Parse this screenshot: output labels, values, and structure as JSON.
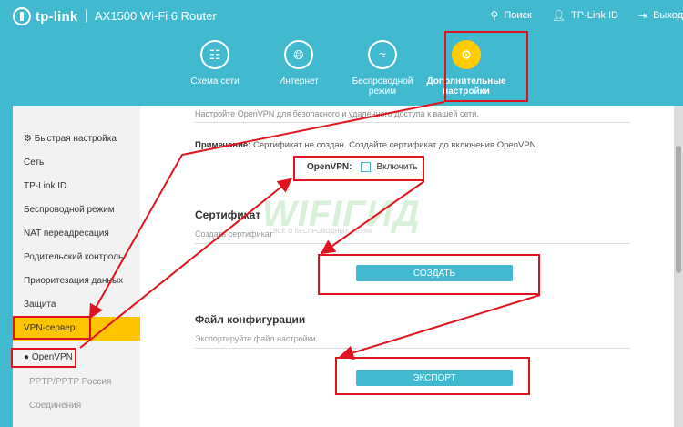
{
  "header": {
    "logo_text": "tp-link",
    "model": "AX1500 Wi-Fi 6 Router",
    "actions": [
      {
        "label": "Поиск",
        "icon": "search-icon"
      },
      {
        "label": "TP-Link ID",
        "icon": "user-icon"
      },
      {
        "label": "Выход",
        "icon": "logout-icon"
      }
    ]
  },
  "nav": {
    "items": [
      {
        "label": "Схема сети",
        "icon": "network-map-icon"
      },
      {
        "label": "Интернет",
        "icon": "globe-icon"
      },
      {
        "label": "Беспроводной режим",
        "icon": "wifi-icon"
      },
      {
        "label": "Дополнительные настройки",
        "icon": "gear-icon",
        "active": true
      }
    ]
  },
  "sidebar": {
    "items": [
      {
        "label": "Быстрая настройка",
        "icon": "gear-icon"
      },
      {
        "label": "Сеть"
      },
      {
        "label": "TP-Link ID"
      },
      {
        "label": "Беспроводной режим"
      },
      {
        "label": "NAT переадресация"
      },
      {
        "label": "Родительский контроль"
      },
      {
        "label": "Приоритезация данных"
      },
      {
        "label": "Защита"
      },
      {
        "label": "VPN-сервер",
        "active": true
      },
      {
        "label": "OpenVPN",
        "selected": true
      },
      {
        "label": "PPTP/PPTP Россия"
      },
      {
        "label": "Соединения"
      }
    ]
  },
  "main": {
    "intro": "Настройте OpenVPN для безопасного и удаленного доступа к вашей сети.",
    "note_label": "Примечание:",
    "note_text": " Сертификат не создан. Создайте сертификат до включения OpenVPN.",
    "openvpn_label": "OpenVPN:",
    "enable_label": "Включить",
    "enable_checked": false,
    "certificate": {
      "title": "Сертификат",
      "subtitle": "Создать сертификат",
      "button": "СОЗДАТЬ"
    },
    "config": {
      "title": "Файл конфигурации",
      "subtitle": "Экспортируйте файл настройки.",
      "button": "ЭКСПОРТ"
    }
  },
  "watermark": {
    "text": "WIFIГИД",
    "sub": "ВСЁ О БЕСПРОВОДНЫХ СЕТЯХ"
  },
  "colors": {
    "brand": "#41b9cf",
    "active_nav": "#ffcc00",
    "sidebar_active": "#ffc400",
    "annotation": "#e0141e"
  }
}
